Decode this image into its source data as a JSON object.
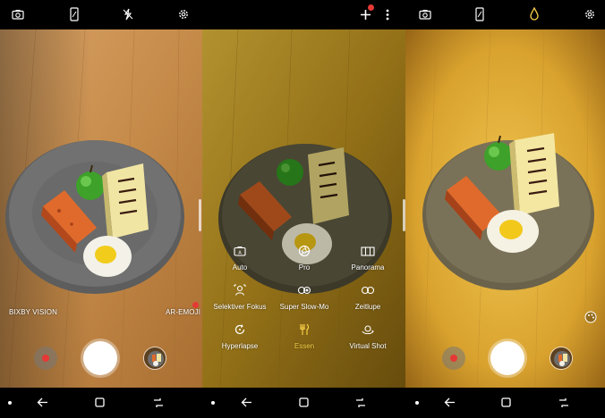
{
  "panel1": {
    "top_icons": [
      "switch-camera-icon",
      "phone-ratio-icon",
      "flash-off-icon",
      "settings-gear-icon"
    ],
    "bixby_label": "BIXBY VISION",
    "ar_label": "AR-EMOJI",
    "ar_badge": "N",
    "nav_icons": [
      "dot-icon",
      "back-arrow-icon",
      "home-square-icon",
      "recents-icon"
    ]
  },
  "panel2": {
    "top_icons": [
      "add-mode-icon",
      "more-options-icon"
    ],
    "add_badge": "N",
    "modes": [
      {
        "label": "Auto",
        "icon": "auto-camera-icon",
        "active": false
      },
      {
        "label": "Pro",
        "icon": "pro-aperture-icon",
        "active": false
      },
      {
        "label": "Panorama",
        "icon": "panorama-icon",
        "active": false
      },
      {
        "label": "Selektiver Fokus",
        "icon": "selective-focus-icon",
        "active": false
      },
      {
        "label": "Super Slow-Mo",
        "icon": "super-slowmo-icon",
        "active": false
      },
      {
        "label": "Zeitlupe",
        "icon": "slow-motion-icon",
        "active": false
      },
      {
        "label": "Hyperlapse",
        "icon": "hyperlapse-icon",
        "active": false
      },
      {
        "label": "Essen",
        "icon": "food-icon",
        "active": true
      },
      {
        "label": "Virtual Shot",
        "icon": "virtual-shot-icon",
        "active": false
      }
    ],
    "nav_icons": [
      "dot-icon",
      "back-arrow-icon",
      "home-square-icon",
      "recents-icon"
    ]
  },
  "panel3": {
    "top_icons": [
      "switch-camera-icon",
      "phone-ratio-icon",
      "water-drop-icon",
      "settings-gear-icon"
    ],
    "nav_icons": [
      "dot-icon",
      "back-arrow-icon",
      "home-square-icon",
      "recents-icon"
    ]
  },
  "colors": {
    "accent_yellow": "#ffd54a",
    "record_red": "#e53935",
    "wood": "#c98a45",
    "plate": "#6f6f6f"
  }
}
